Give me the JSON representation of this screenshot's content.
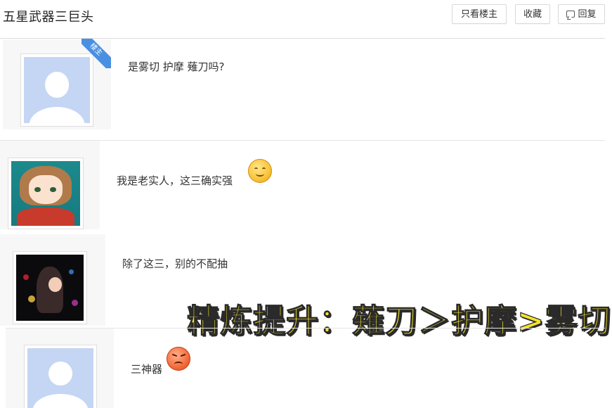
{
  "thread": {
    "title": "五星武器三巨头"
  },
  "toolbar": {
    "only_op_label": "只看楼主",
    "favorite_label": "收藏",
    "reply_label": "回复"
  },
  "posts": [
    {
      "badge": "楼主",
      "avatar": "default-avatar",
      "text": "是雾切 护摩 薙刀吗?"
    },
    {
      "avatar": "anime-girl-avatar",
      "text": "我是老实人，这三确实强",
      "emoji": "smile-emoji"
    },
    {
      "avatar": "dark-character-avatar",
      "text": "除了这三，别的不配抽"
    },
    {
      "avatar": "default-avatar",
      "text": "三神器",
      "emoji": "angry-emoji"
    }
  ],
  "overlay": {
    "caption": "精炼提升：薙刀＞护摩>雾切"
  },
  "colors": {
    "badge_blue": "#4a90e2",
    "caption_yellow": "#f4e32a",
    "default_avatar_bg": "#c5d6f4"
  }
}
